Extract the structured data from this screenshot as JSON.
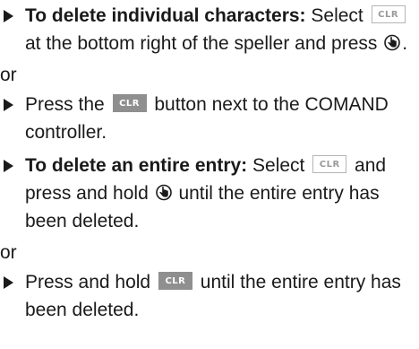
{
  "steps": [
    {
      "bold": "To delete individual characters:",
      "t1": " Select ",
      "key": "CLR",
      "t2": " at the bottom right of the speller and press ",
      "t3": "."
    },
    {
      "or": "or",
      "t1": "Press the ",
      "key": "CLR",
      "t2": " button next to the COMAND controller."
    },
    {
      "bold": "To delete an entire entry:",
      "t1": " Select ",
      "key": "CLR",
      "t2": " and press and hold ",
      "t3": " until the entire entry has been deleted."
    },
    {
      "or": "or",
      "t1": "Press and hold ",
      "key": "CLR",
      "t2": " until the entire entry has been deleted."
    }
  ],
  "icons": {
    "controller": "controller-press-icon",
    "bullet": "bullet-triangle-icon"
  }
}
